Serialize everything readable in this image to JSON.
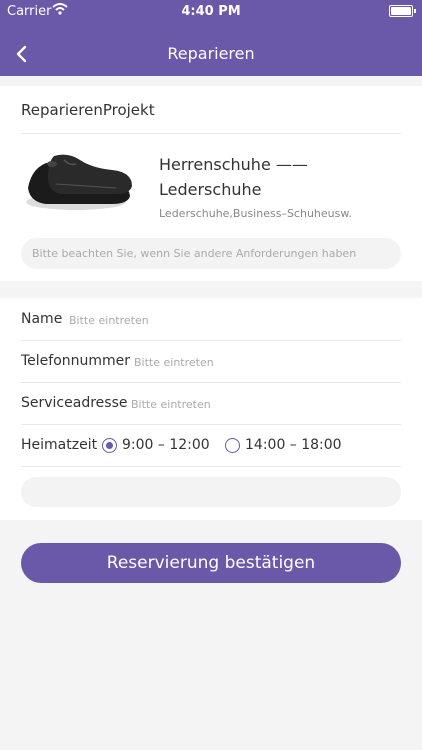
{
  "status_bar": {
    "carrier": "Carrier",
    "time": "4:40 PM"
  },
  "nav": {
    "title": "Reparieren"
  },
  "project": {
    "section_title": "ReparierenProjekt",
    "product_name": "Herrenschuhe —— Lederschuhe",
    "product_desc": "Lederschuhe,Business–Schuheusw.",
    "note_placeholder": "Bitte beachten Sie, wenn Sie andere Anforderungen haben"
  },
  "form": {
    "name_label": "Name",
    "name_placeholder": "Bitte eintreten",
    "phone_label": "Telefonnummer",
    "phone_placeholder": "Bitte eintreten",
    "address_label": "Serviceadresse",
    "address_placeholder": "Bitte eintreten",
    "time_label": "Heimatzeit",
    "time_options": [
      {
        "label": "9:00 – 12:00",
        "selected": true
      },
      {
        "label": "14:00 – 18:00",
        "selected": false
      }
    ]
  },
  "confirm_label": "Reservierung bestätigen",
  "colors": {
    "accent": "#6a58a8"
  }
}
